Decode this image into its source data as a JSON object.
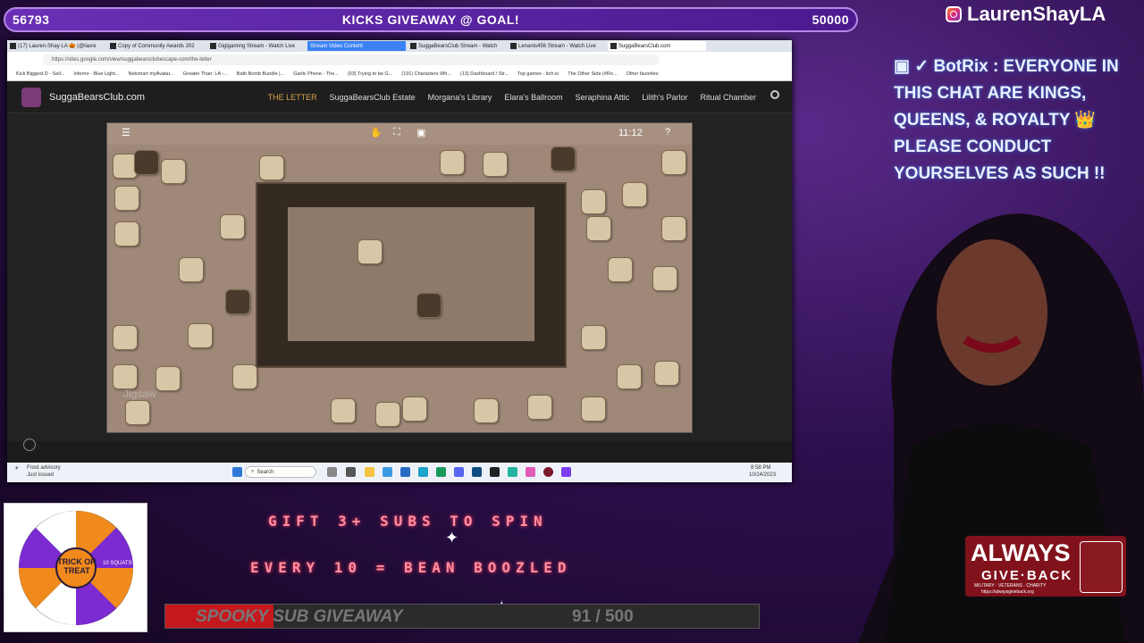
{
  "goal": {
    "current": "56793",
    "title": "KICKS GIVEAWAY @ GOAL!",
    "target": "50000"
  },
  "instagram": {
    "handle": "LaurenShayLA"
  },
  "chat": {
    "author": "BotRix",
    "message": ": EVERYONE IN THIS CHAT ARE KINGS, QUEENS, & ROYALTY 👑 PLEASE CONDUCT YOURSELVES AS SUCH !!"
  },
  "browser": {
    "tabs": [
      {
        "label": "(17) Lauren-Shay LA 🎃 (@laure"
      },
      {
        "label": "Copy of Community Awards 202"
      },
      {
        "label": "Gigigaming Stream - Watch Live"
      },
      {
        "label": "Stream Video Content"
      },
      {
        "label": "SuggaBearsClub Stream - Watch"
      },
      {
        "label": "Lenanis456 Stream - Watch Live"
      },
      {
        "label": "SuggaBearsClub.com"
      }
    ],
    "url": "https://sites.google.com/view/suggabearsclubescape-com/the-letter",
    "bookmarks": [
      "Kick Biggest D - Sell...",
      "Inferno - Blue Light...",
      "Netsmart myAvatar...",
      "Greater Than: LA -...",
      "Bath Bomb Bundle |...",
      "Garlic Phone - The...",
      "(93) Trying to be G...",
      "(191) Characters Wh...",
      "(13) Dashboard / Str...",
      "Top games - itch.io",
      "The Other Side (#Ro...",
      "Other favorites"
    ]
  },
  "site": {
    "name": "SuggaBearsClub.com",
    "nav": [
      "THE LETTER",
      "SuggaBearsClub Estate",
      "Morgana's Library",
      "Elara's Ballroom",
      "Seraphina Attic",
      "Lilith's Parlor",
      "Ritual Chamber"
    ]
  },
  "puzzle": {
    "timer": "11:12",
    "watermark": "Jigsaw"
  },
  "taskbar": {
    "search_placeholder": "Search",
    "weather_title": "Frost advisory",
    "weather_sub": "Just issued",
    "time": "8:58 PM",
    "date": "10/24/2023"
  },
  "wheel": {
    "center_label": "TRICK OR TREAT",
    "segment_label": "10 SQUATS"
  },
  "overlay": {
    "gift": "GIFT 3+ SUBS TO SPIN",
    "every": "EVERY 10 = BEAN BOOZLED"
  },
  "spooky": {
    "label": "SPOOKY SUB GIVEAWAY",
    "count": "91 / 500",
    "progress": 0.182
  },
  "agb": {
    "line1": "ALWAYS",
    "line2": "GIVE·BACK",
    "line3": "MILITARY · VETERANS · CHARITY",
    "line4": "https://alwaysgiveback.org"
  },
  "colors": {
    "goal_bg": "#6a2fb6",
    "spooky_fill": "#c5181e",
    "site_accent": "#d8a44b",
    "chat_glow": "#3a6bd0"
  }
}
